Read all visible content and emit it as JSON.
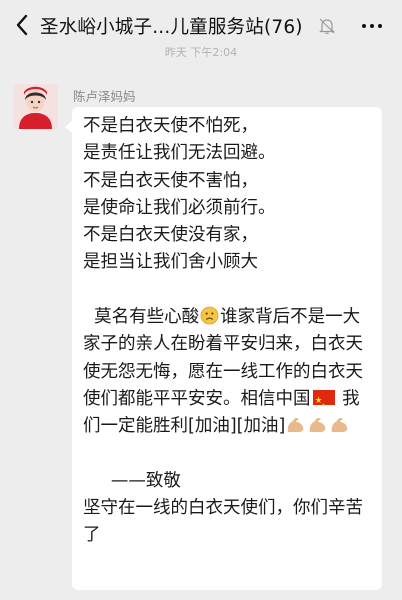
{
  "header": {
    "title": "圣水峪小城子...儿童服务站(76)",
    "back_icon": "chevron-left-icon",
    "mute_icon": "bell-muted-icon",
    "more_icon": "more-dots-icon"
  },
  "timestamp": "昨天 下午2:04",
  "message": {
    "sender": "陈卢泽妈妈",
    "lines": {
      "l1": "不是白衣天使不怕死，",
      "l2": "是责任让我们无法回避。",
      "l3": "不是白衣天使不害怕，",
      "l4": "是使命让我们必须前行。",
      "l5": "不是白衣天使没有家，",
      "l6": "是担当让我们舍小顾大",
      "p2a": "  莫名有些心酸",
      "p2b": "谁家背后不是一大家子的亲人在盼着平安归来，白衣天使无怨无悔，愿在一线工作的白衣天使们都能平平安安。相信中国",
      "p2c": " 我们一定能胜利[加油][加油]",
      "sign": "     ——致敬",
      "last": "坚守在一线的白衣天使们，你们辛苦了"
    },
    "emojis": [
      "sad-face-emoji",
      "china-flag-emoji",
      "flexed-biceps-emoji"
    ]
  },
  "colors": {
    "background": "#ededed",
    "bubble": "#ffffff",
    "text": "#1a1a1a"
  }
}
